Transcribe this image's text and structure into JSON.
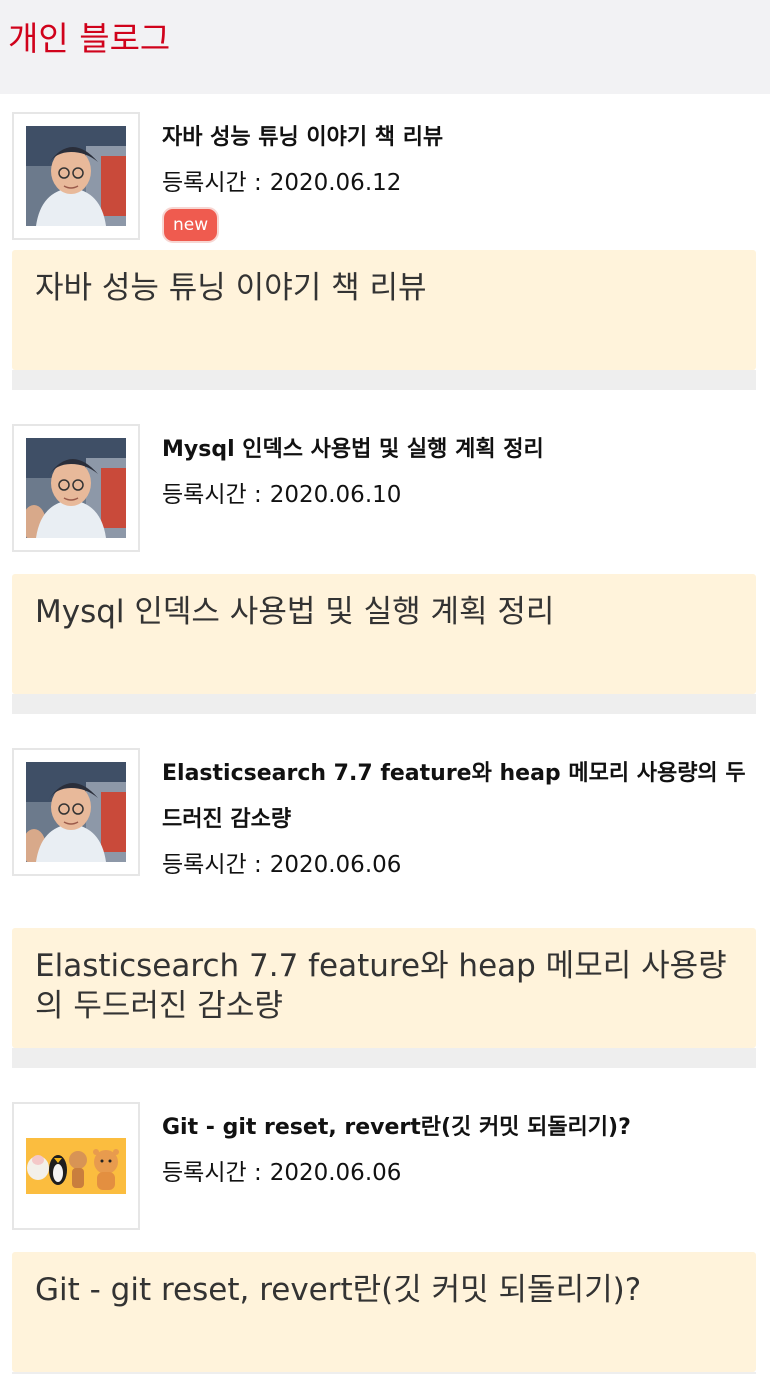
{
  "app": {
    "title": "개인 블로그"
  },
  "date_prefix": "등록시간 :",
  "posts": [
    {
      "title": "자바 성능 튜닝 이야기 책 리뷰",
      "date": "2020.06.12",
      "badge": "new",
      "body": "자바 성능 튜닝 이야기 책 리뷰",
      "thumb_icon": "author-avatar-photo"
    },
    {
      "title": "Mysql 인덱스 사용법 및 실행 계획 정리",
      "date": "2020.06.10",
      "body": "Mysql 인덱스 사용법 및 실행 계획 정리",
      "thumb_icon": "author-avatar-photo"
    },
    {
      "title": "Elasticsearch 7.7 feature와 heap 메모리 사용량의 두드러진 감소량",
      "date": "2020.06.06",
      "body": "Elasticsearch 7.7 feature와 heap 메모리 사용량의 두드러진 감소량",
      "thumb_icon": "author-avatar-photo"
    },
    {
      "title": "Git - git reset, revert란(깃 커밋 되돌리기)?",
      "date": "2020.06.06",
      "body": "Git - git reset, revert란(깃 커밋 되돌리기)?",
      "thumb_icon": "cartoon-characters-image"
    }
  ],
  "colors": {
    "title_red": "#d0021b",
    "header_bg": "#f2f2f4",
    "card_bg": "#fff3db",
    "separator": "#eeeeee",
    "badge_red": "#ef5b4f"
  }
}
